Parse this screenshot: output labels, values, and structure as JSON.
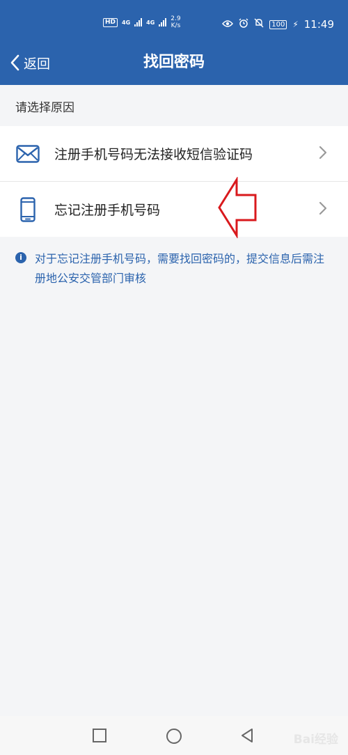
{
  "status_bar": {
    "hd_label": "HD",
    "network_1": "4G",
    "network_2": "4G",
    "speed_value": "2.9",
    "speed_unit": "K/s",
    "battery": "100",
    "time": "11:49"
  },
  "nav": {
    "back_label": "返回",
    "title": "找回密码"
  },
  "section_label": "请选择原因",
  "options": [
    {
      "label": "注册手机号码无法接收短信验证码",
      "icon": "mail-icon"
    },
    {
      "label": "忘记注册手机号码",
      "icon": "phone-icon"
    }
  ],
  "note": "对于忘记注册手机号码，需要找回密码的，提交信息后需注册地公安交管部门审核",
  "watermark": "Bai经验",
  "colors": {
    "primary": "#2b63ad",
    "background": "#f4f5f7",
    "annotation": "#d9191d"
  }
}
